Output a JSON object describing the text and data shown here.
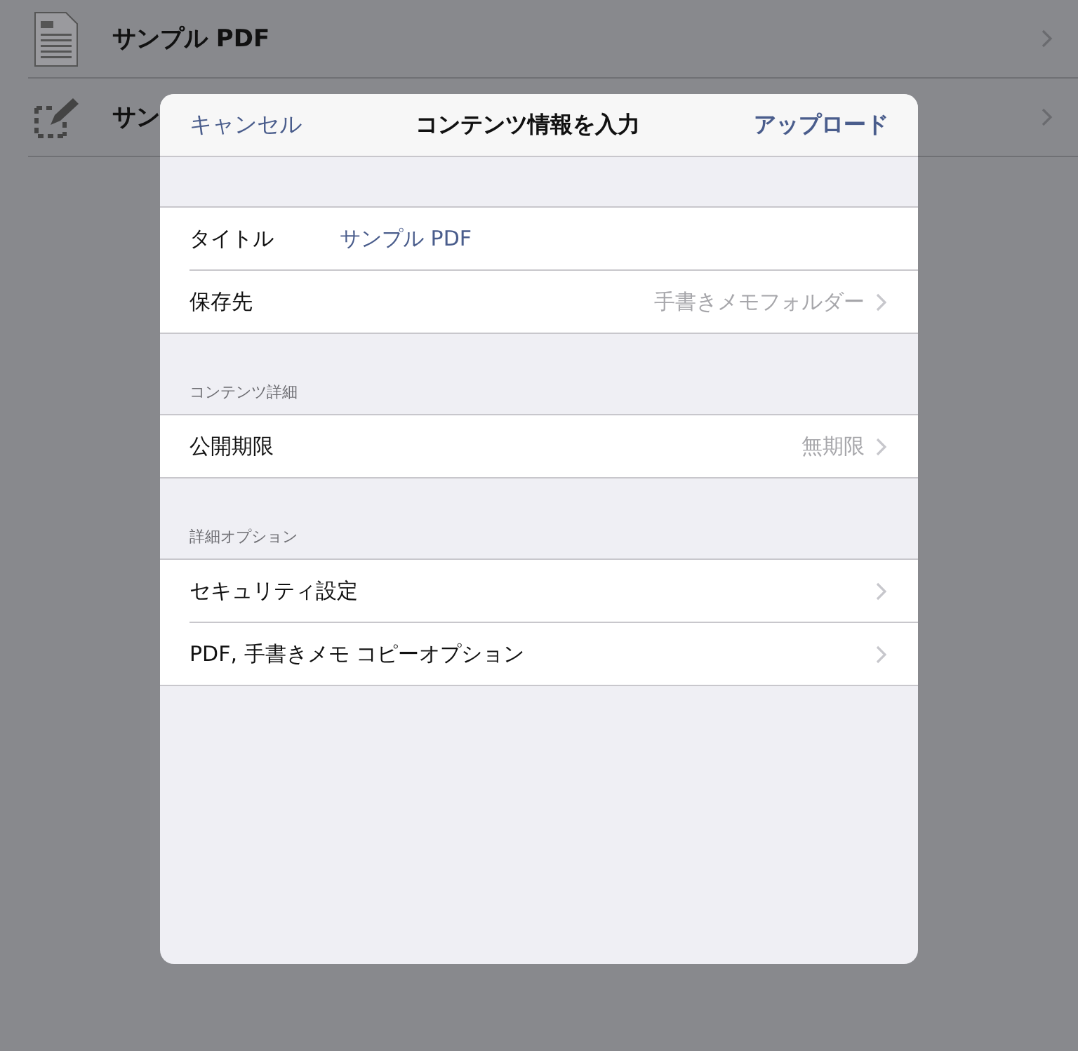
{
  "background_list": [
    {
      "kind": "document",
      "title": "サンプル PDF"
    },
    {
      "kind": "memo",
      "title": "サン"
    }
  ],
  "dialog": {
    "cancel": "キャンセル",
    "title": "コンテンツ情報を入力",
    "upload": "アップロード",
    "sections": [
      {
        "rows": [
          {
            "kind": "field",
            "label": "タイトル",
            "value": "サンプル PDF"
          },
          {
            "kind": "disclosure",
            "label": "保存先",
            "value": "手書きメモフォルダー"
          }
        ]
      },
      {
        "header": "コンテンツ詳細",
        "rows": [
          {
            "kind": "disclosure",
            "label": "公開期限",
            "value": "無期限"
          }
        ]
      },
      {
        "header": "詳細オプション",
        "rows": [
          {
            "kind": "disclosure",
            "label": "セキュリティ設定"
          },
          {
            "kind": "disclosure",
            "label": "PDF, 手書きメモ コピーオプション"
          }
        ]
      }
    ]
  }
}
